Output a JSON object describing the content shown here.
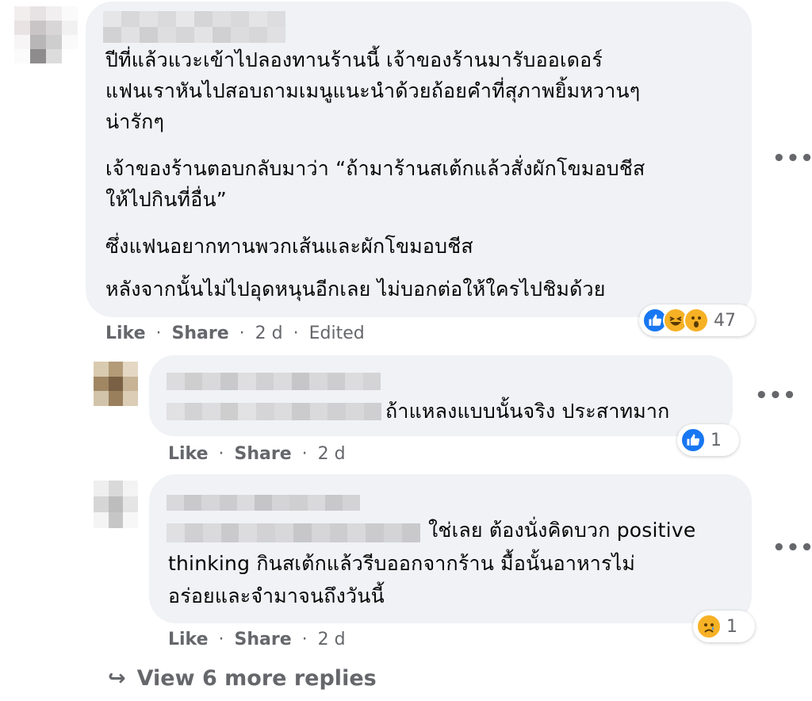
{
  "comment": {
    "lines_p1": [
      "ปีที่แล้วแวะเข้าไปลองทานร้านนี้ เจ้าของร้านมารับออเดอร์",
      "แฟนเราหันไปสอบถามเมนูแนะนำด้วยถ้อยคำที่สุภาพยิ้มหวานๆ",
      "น่ารักๆ"
    ],
    "lines_p2": [
      "เจ้าของร้านตอบกลับมาว่า “ถ้ามาร้านสเต้กแล้วสั่งผักโขมอบชีส",
      "ให้ไปกินที่อื่น”"
    ],
    "line_p3": "ซึ่งแฟนอยากทานพวกเส้นและผักโขมอบชีส",
    "line_p4": "หลังจากนั้นไม่ไปอุดหนุนอีกเลย ไม่บอกต่อให้ใครไปชิมด้วย",
    "like": "Like",
    "share": "Share",
    "sep": "·",
    "time": "2 d",
    "edited": "Edited",
    "reactions": [
      "like",
      "haha",
      "wow"
    ],
    "reaction_count": "47",
    "more": "•••"
  },
  "reply1": {
    "text": "ถ้าแหลงแบบนั้นจริง ประสาทมาก",
    "like": "Like",
    "share": "Share",
    "time": "2 d",
    "reactions": [
      "like"
    ],
    "reaction_count": "1",
    "more": "•••"
  },
  "reply2": {
    "line1": "ใช่เลย ต้องนั่งคิดบวก positive",
    "line2": "thinking กินสเต้กแล้วรีบออกจากร้าน มื้อนั้นอาหารไม่",
    "line3": "อร่อยและจำมาจนถึงวันนี้",
    "like": "Like",
    "share": "Share",
    "time": "2 d",
    "reactions": [
      "sad"
    ],
    "reaction_count": "1",
    "more": "•••"
  },
  "view_more": {
    "arrow": "↪",
    "label": "View 6 more replies"
  },
  "colors": {
    "bubble": "#f0f2f5",
    "meta": "#65676b",
    "like_blue": "#1877f2",
    "emoji_yellow": "#f7b125"
  }
}
